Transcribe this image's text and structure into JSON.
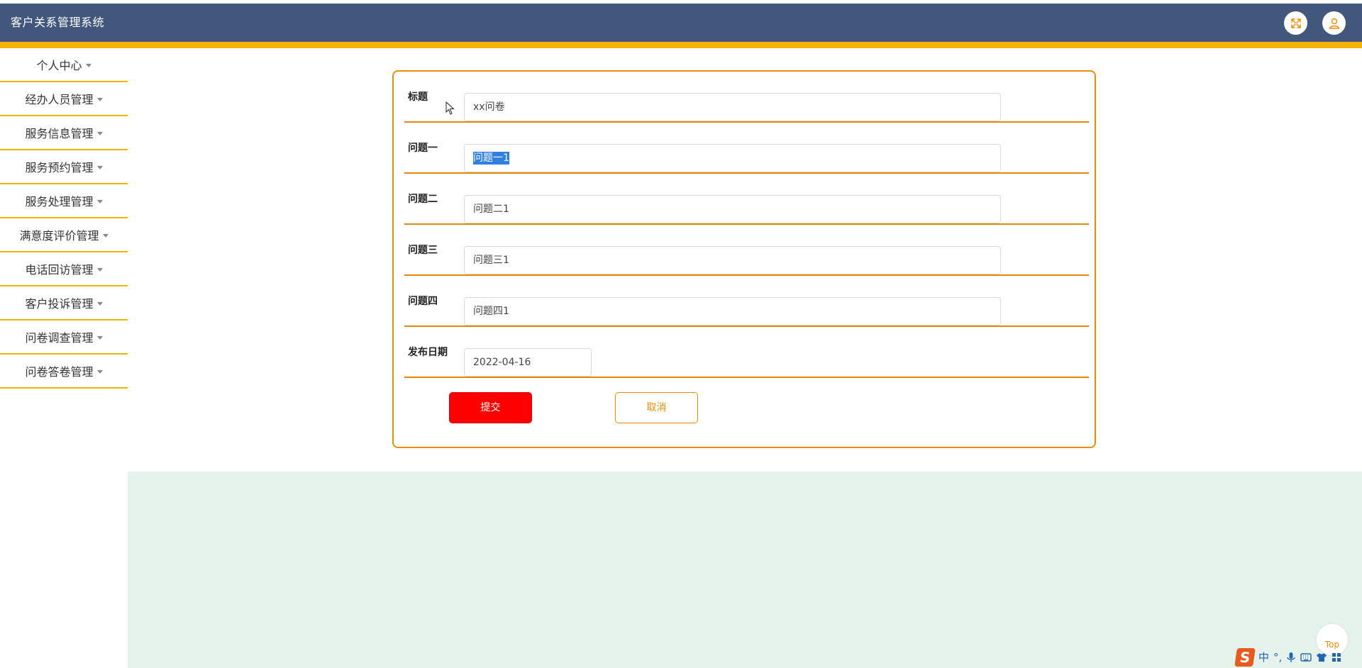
{
  "app": {
    "title": "客户关系管理系统"
  },
  "header": {
    "icons": [
      "fullscreen-icon",
      "user-icon"
    ]
  },
  "colors": {
    "header_bg": "#41577c",
    "accent": "#f5b106",
    "form_border": "#f08c00",
    "submit_bg": "#ff0000",
    "content_bg": "#e5f3ec"
  },
  "sidebar": {
    "items": [
      {
        "label": "个人中心"
      },
      {
        "label": "经办人员管理"
      },
      {
        "label": "服务信息管理"
      },
      {
        "label": "服务预约管理"
      },
      {
        "label": "服务处理管理"
      },
      {
        "label": "满意度评价管理"
      },
      {
        "label": "电话回访管理"
      },
      {
        "label": "客户投诉管理"
      },
      {
        "label": "问卷调查管理"
      },
      {
        "label": "问卷答卷管理"
      }
    ]
  },
  "form": {
    "fields": [
      {
        "label": "标题",
        "value": "xx问卷"
      },
      {
        "label": "问题一",
        "value": "问题一1"
      },
      {
        "label": "问题二",
        "value": "问题二1"
      },
      {
        "label": "问题三",
        "value": "问题三1"
      },
      {
        "label": "问题四",
        "value": "问题四1"
      },
      {
        "label": "发布日期",
        "value": "2022-04-16"
      }
    ],
    "submit_label": "提交",
    "cancel_label": "取消"
  },
  "footer": {
    "top_label": "Top",
    "ime": {
      "logo": "S",
      "mode": "中",
      "punct": "°,"
    }
  }
}
